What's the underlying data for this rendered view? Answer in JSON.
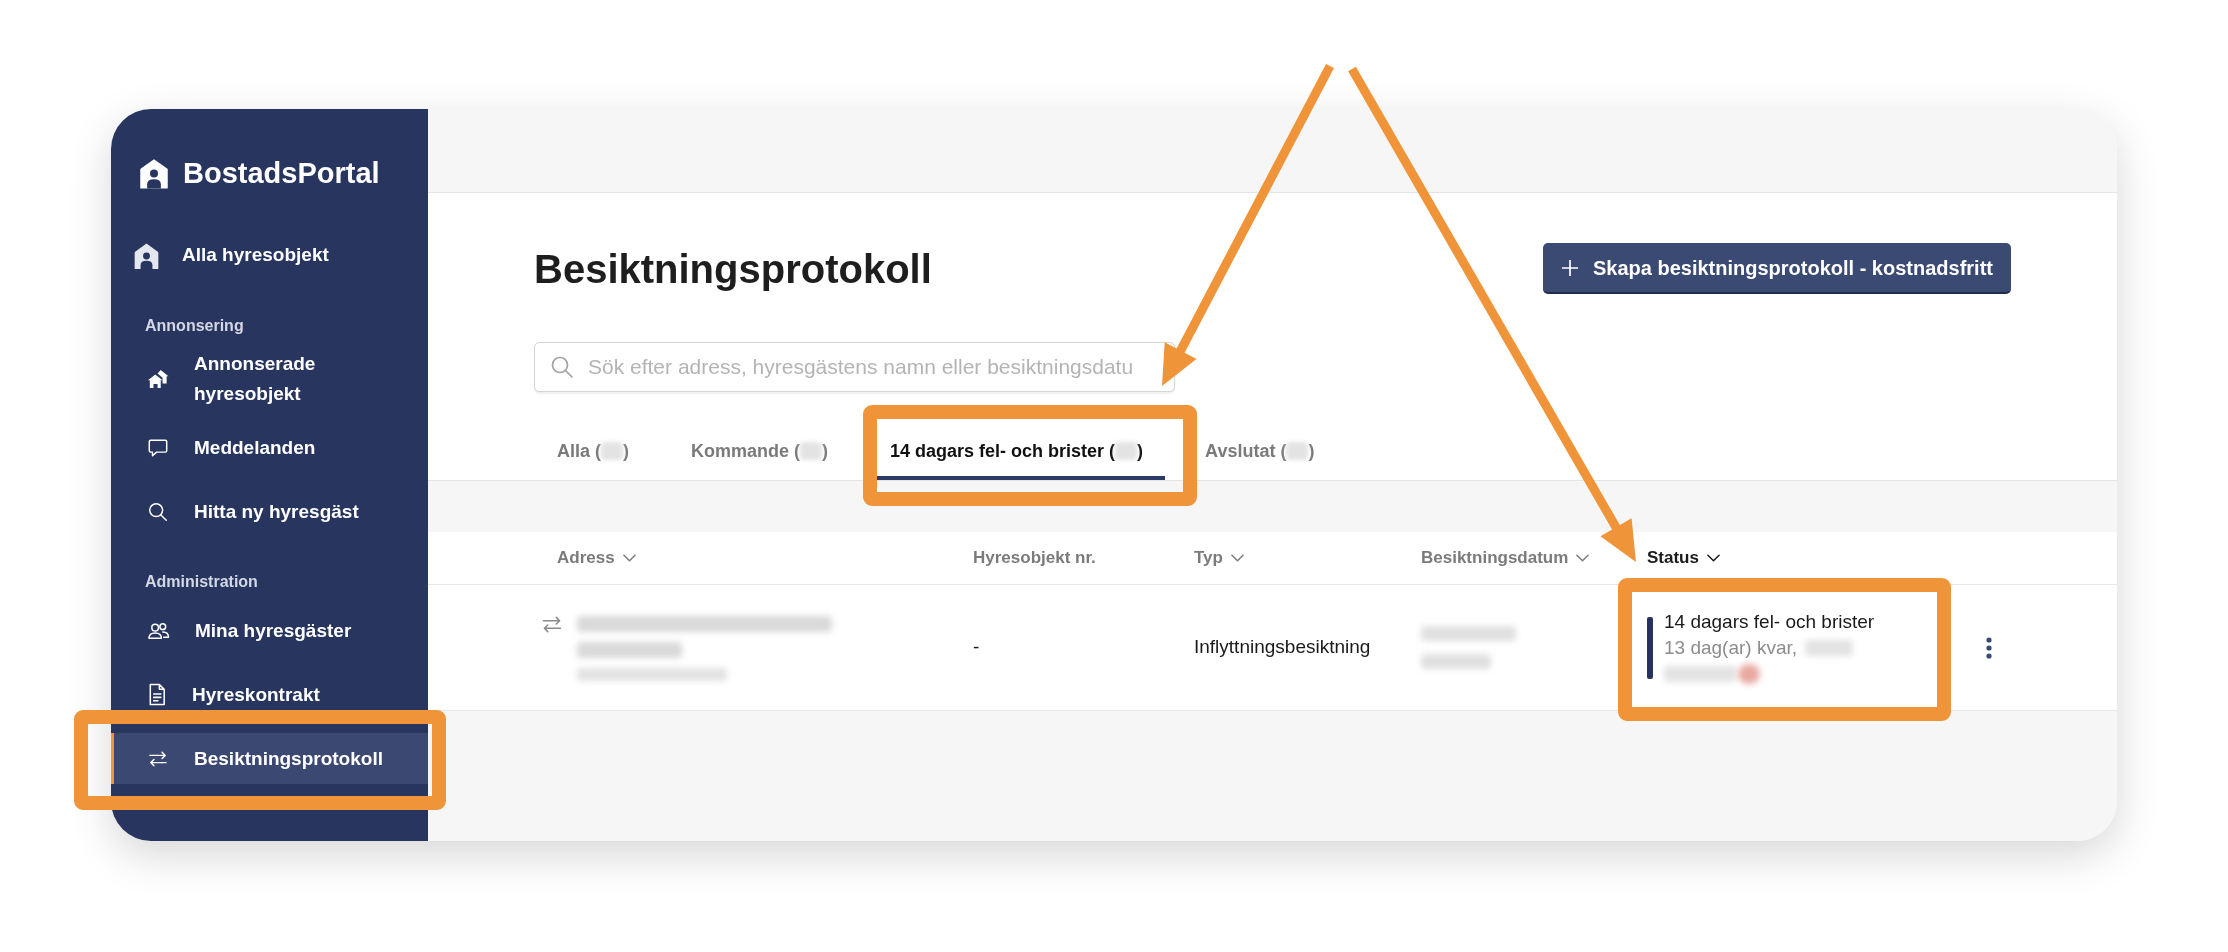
{
  "sidebar": {
    "logo": "BostadsPortal",
    "top_items": [
      {
        "label": "Alla hyresobjekt",
        "selected": false
      }
    ],
    "sections": [
      {
        "title": "Annonsering",
        "items": [
          {
            "label": "Annonserade hyresobjekt",
            "selected": false
          },
          {
            "label": "Meddelanden",
            "selected": false
          },
          {
            "label": "Hitta ny hyresgäst",
            "selected": false
          }
        ]
      },
      {
        "title": "Administration",
        "items": [
          {
            "label": "Mina hyresgäster",
            "selected": false
          },
          {
            "label": "Hyreskontrakt",
            "selected": false
          },
          {
            "label": "Besiktningsprotokoll",
            "selected": true
          }
        ]
      }
    ]
  },
  "page": {
    "title": "Besiktningsprotokoll",
    "create_button": "Skapa besiktningsprotokoll - kostnadsfritt"
  },
  "search": {
    "placeholder": "Sök efter adress, hyresgästens namn eller besiktningsdatu"
  },
  "tabs": [
    {
      "text_before": "Alla (",
      "text_after": ")",
      "selected": false
    },
    {
      "text_before": "Kommande (",
      "text_after": ")",
      "selected": false
    },
    {
      "text_before": "14 dagars fel- och brister (",
      "text_after": ")",
      "selected": true
    },
    {
      "text_before": "Avslutat (",
      "text_after": ")",
      "selected": false
    }
  ],
  "table": {
    "columns": [
      {
        "label": "Adress",
        "sortable": true,
        "sorted": false
      },
      {
        "label": "Hyresobjekt nr.",
        "sortable": false,
        "sorted": false
      },
      {
        "label": "Typ",
        "sortable": true,
        "sorted": false
      },
      {
        "label": "Besiktningsdatum",
        "sortable": true,
        "sorted": false
      },
      {
        "label": "Status",
        "sortable": true,
        "sorted": true
      }
    ],
    "rows": [
      {
        "object_nr": "-",
        "type": "Inflyttningsbesiktning",
        "status": {
          "title": "14 dagars fel- och brister",
          "detail": "13 dag(ar) kvar,",
          "color": "#27325e"
        }
      }
    ]
  }
}
